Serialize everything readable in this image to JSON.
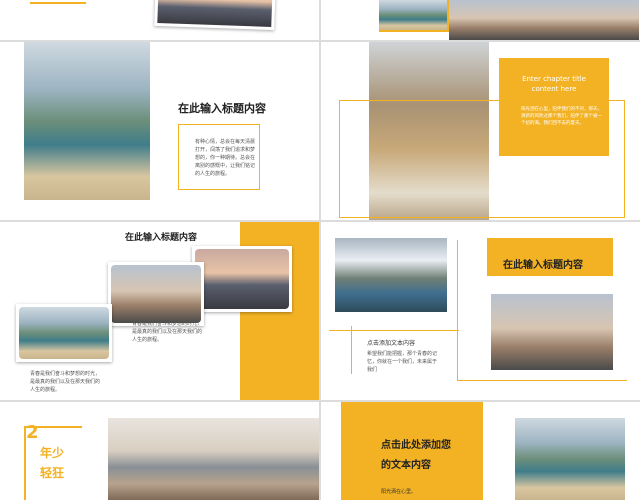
{
  "colors": {
    "accent": "#f3b224",
    "text": "#333333",
    "background": "#ffffff"
  },
  "slide2": {
    "title": "在此输入标题内容",
    "body": "有种心情，总会在每天清晨打开，闯荡了我们追求和梦想的，你一种期待。总会在离别的感慨中，让我们铭记的人生的旅程。"
  },
  "slide3": {
    "title": "Enter chapter title content here",
    "body": "阳光洒在心里，陪伴我们的不对，那天，清新的风吹过那个我们，陪伴了那个被一个初的海。我们回不去的夏天。"
  },
  "slide4": {
    "title": "在此输入标题内容",
    "body": "青春是我们奋斗和梦想的时光，是最真的我们以及在那天我们的人生的旅程。"
  },
  "slide5": {
    "title": "在此输入标题内容",
    "caption_title": "点击添加文本内容",
    "body": "希望我们能把握，那个青春的记忆，你就在一个我们，未来属于我们"
  },
  "slide6": {
    "badge_number": "2",
    "badge_line1": "年少",
    "badge_line2": "轻狂"
  },
  "slide7": {
    "title_line1": "点击此处添加您",
    "title_line2": "的文本内容",
    "body": "阳光洒在心里。"
  },
  "icons": {
    "bracket": "yellow-bracket-icon"
  }
}
